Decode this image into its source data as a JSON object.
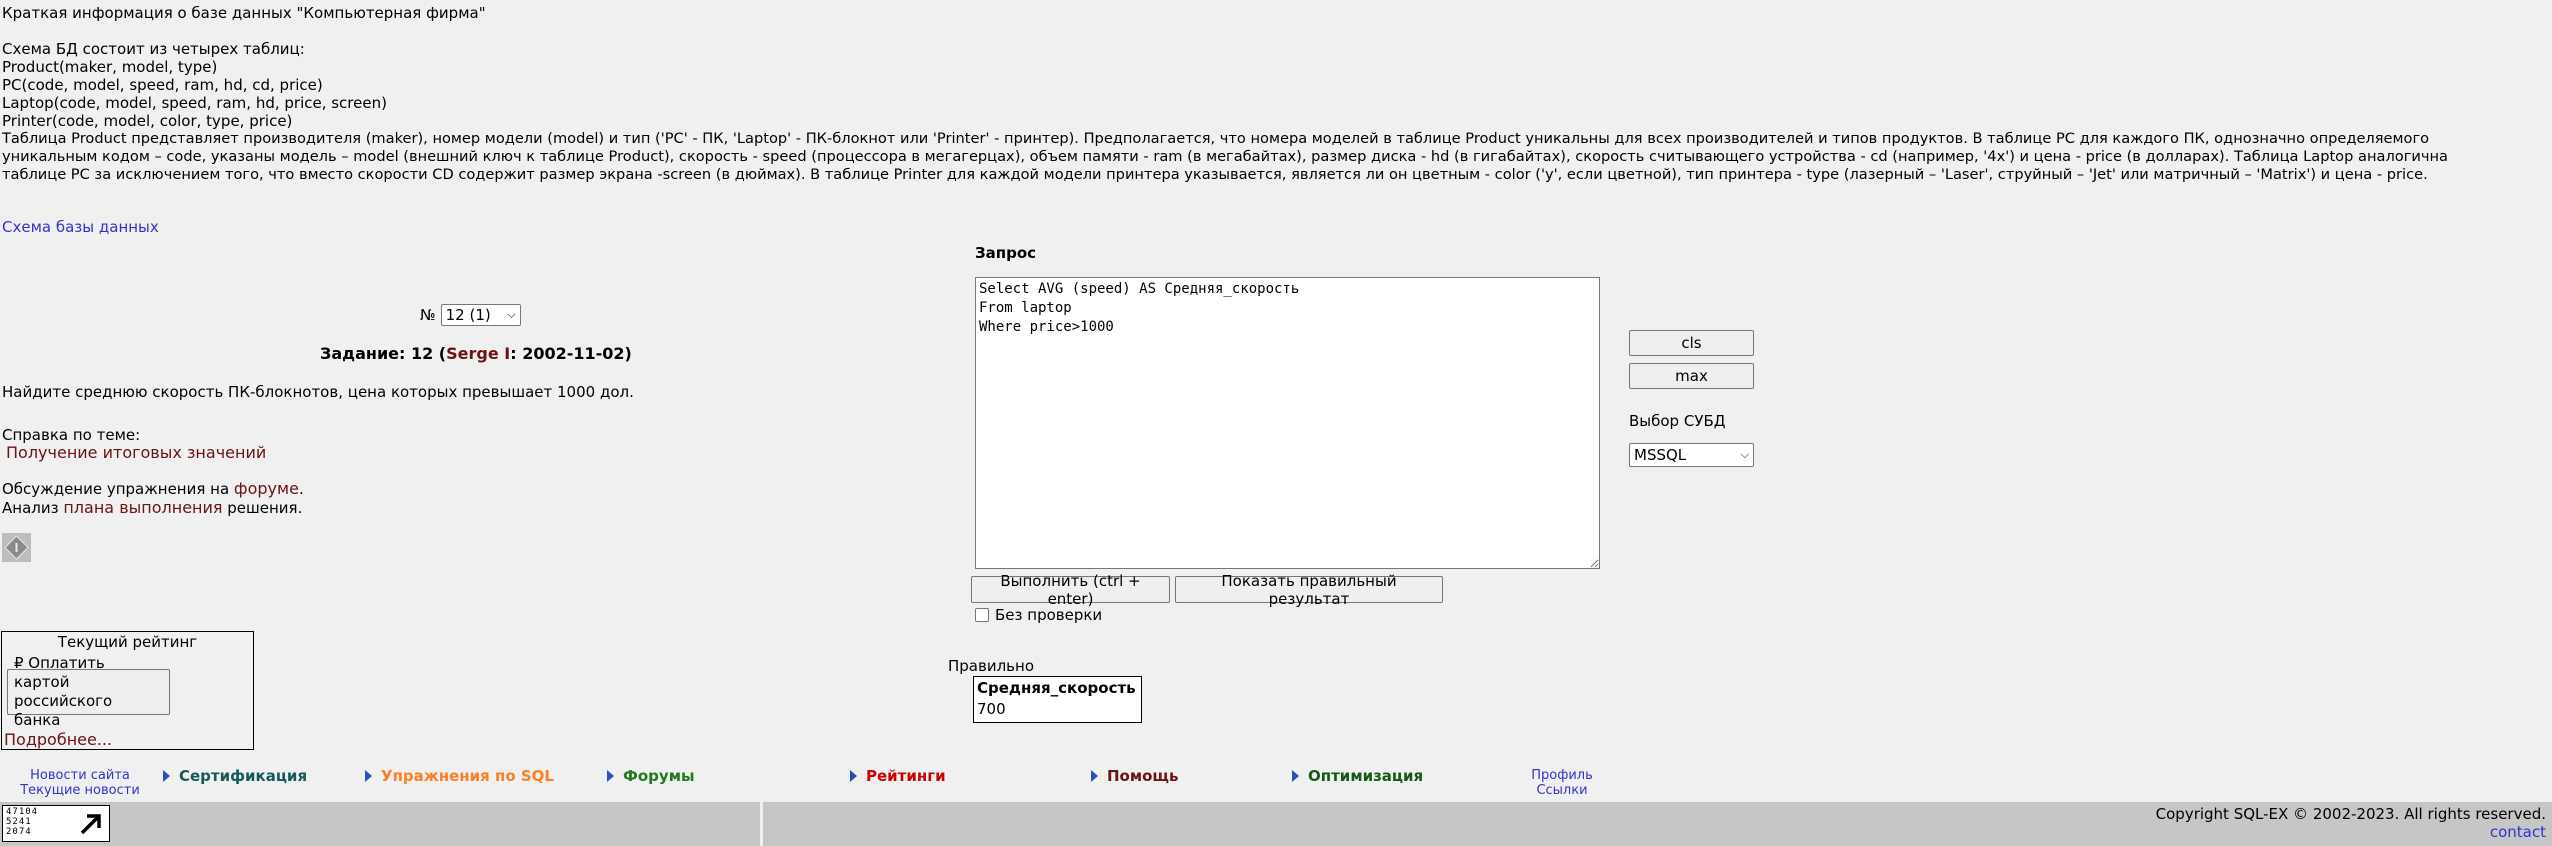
{
  "desc": {
    "title": "Краткая информация о базе данных \"Компьютерная фирма\"",
    "schema_intro": "Схема БД состоит из четырех таблиц:",
    "tables": [
      "Product(maker, model, type)",
      "PC(code, model, speed, ram, hd, cd, price)",
      "Laptop(code, model, speed, ram, hd, price, screen)",
      "Printer(code, model, color, type, price)"
    ],
    "line1": "Таблица Product представляет производителя (maker), номер модели (model) и тип ('PC' - ПК, 'Laptop' - ПК-блокнот или 'Printer' - принтер). Предполагается, что номера моделей в таблице Product уникальны для всех производителей и типов продуктов. В таблице PC для каждого ПК, однозначно определяемого",
    "line2": "уникальным кодом – code, указаны модель – model (внешний ключ к таблице Product), скорость - speed (процессора в мегагерцах), объем памяти - ram (в мегабайтах), размер диска - hd (в гигабайтах), скорость считывающего устройства - cd (например, '4x') и цена - price (в долларах). Таблица Laptop аналогична",
    "line3": "таблице PC за исключением того, что вместо скорости CD содержит размер экрана -screen (в дюймах). В таблице Printer для каждой модели принтера указывается, является ли он цветным - color ('y', если цветной), тип принтера - type (лазерный – 'Laser', струйный – 'Jet' или матричный – 'Matrix') и цена - price."
  },
  "schema_link": "Схема базы данных",
  "task": {
    "number_label": "№",
    "number_value": "12 (1)",
    "heading_prefix": "Задание: 12 (",
    "author": "Serge I",
    "heading_suffix": ": 2002-11-02)",
    "text": "Найдите среднюю скорость ПК-блокнотов, цена которых превышает 1000 дол.",
    "help_label": "Справка по теме:",
    "help_link": "Получение итоговых значений",
    "forum_prefix": "Обсуждение упражнения на ",
    "forum_link": "форуме",
    "forum_suffix": ".",
    "plan_prefix": "Анализ ",
    "plan_link": "плана выполнения",
    "plan_suffix": " решения."
  },
  "query": {
    "label": "Запрос",
    "text": "Select AVG (speed) AS Средняя_скорость\nFrom laptop\nWhere price>1000",
    "run_button": "Выполнить (ctrl + enter)",
    "show_button": "Показать правильный результат",
    "nocheck_label": "Без проверки"
  },
  "side": {
    "cls_button": "cls",
    "max_button": "max",
    "dbms_label": "Выбор СУБД",
    "dbms_value": "MSSQL"
  },
  "rating": {
    "title": "Текущий рейтинг",
    "pay_button_line1": "₽ Оплатить картой",
    "pay_button_line2": "российского банка",
    "more_link": "Подробнее..."
  },
  "result": {
    "status": "Правильно",
    "column": "Средняя_скорость",
    "value": "700"
  },
  "nav": {
    "news": "Новости сайта",
    "current_news": "Текущие новости",
    "items": [
      "Сертификация",
      "Упражнения по SQL",
      "Форумы",
      "Рейтинги",
      "Помощь",
      "Оптимизация"
    ],
    "profile": "Профиль",
    "links": "Ссылки"
  },
  "footer": {
    "counter_line1": "47104",
    "counter_line2": "5241",
    "counter_line3": "2074",
    "copyright": "Copyright SQL-EX © 2002-2023. All rights reserved.",
    "contact": "contact"
  },
  "colors": {
    "link": "#3333cc",
    "maroon": "#6b1414",
    "nav_teal": "#145a5a",
    "nav_orange": "#ff7f27",
    "nav_green": "#1e7b1e",
    "nav_red": "#cc0000",
    "nav_maroon": "#6b1414",
    "nav_darkgreen": "#145a14"
  }
}
